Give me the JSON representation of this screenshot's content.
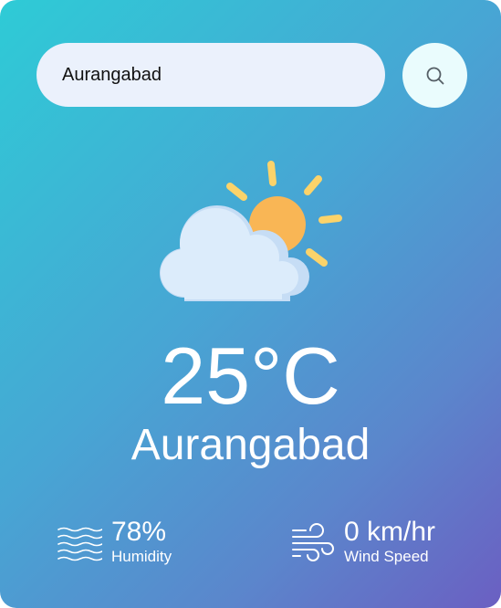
{
  "search": {
    "value": "Aurangabad",
    "placeholder": ""
  },
  "weather": {
    "icon": "partly-cloudy-icon",
    "temperature": "25°C",
    "city": "Aurangabad"
  },
  "details": {
    "humidity": {
      "value": "78%",
      "label": "Humidity",
      "icon": "humidity-waves-icon"
    },
    "wind": {
      "value": "0 km/hr",
      "label": "Wind Speed",
      "icon": "wind-icon"
    }
  },
  "colors": {
    "gradient_start": "#2ecbd6",
    "gradient_end": "#6b5fc2",
    "sun": "#f9b655",
    "sun_rays": "#fbd36a",
    "cloud": "#dcecfb",
    "search_bg": "#ebf1fc",
    "search_button_bg": "#eafcfd"
  }
}
